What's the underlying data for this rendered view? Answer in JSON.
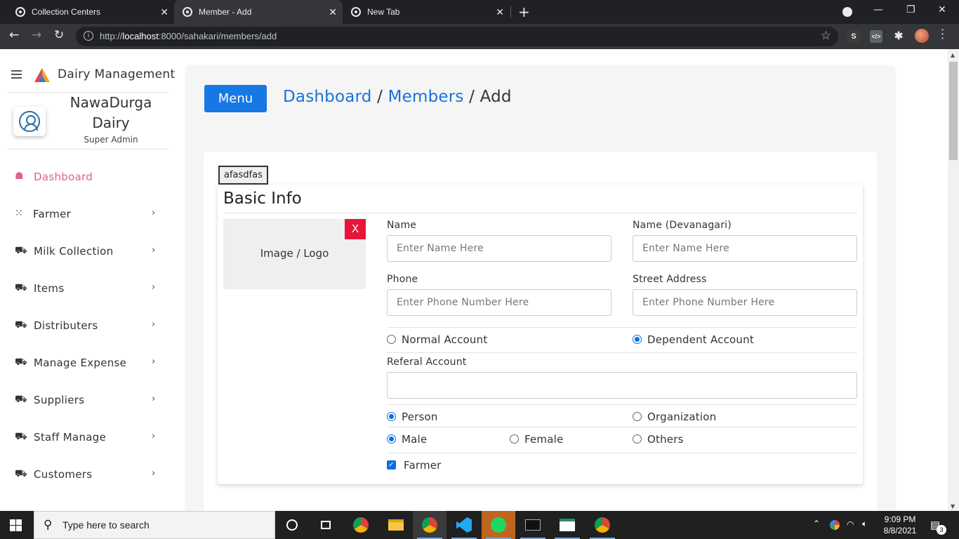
{
  "browser": {
    "tabs": [
      {
        "title": "Collection Centers"
      },
      {
        "title": "Member - Add"
      },
      {
        "title": "New Tab"
      }
    ],
    "url_host": "localhost",
    "url_prefix": "http://",
    "url_rest": ":8000/sahakari/members/add",
    "extensions": [
      "S",
      "</>"
    ]
  },
  "sidebar": {
    "app_title": "Dairy Management",
    "org_name": "NawaDurga Dairy",
    "org_role": "Super Admin",
    "items": [
      {
        "label": "Dashboard",
        "icon": "home-icon",
        "active": true
      },
      {
        "label": "Farmer",
        "icon": "grid-icon"
      },
      {
        "label": "Milk Collection",
        "icon": "cart-icon"
      },
      {
        "label": "Items",
        "icon": "cart-icon"
      },
      {
        "label": "Distributers",
        "icon": "cart-icon"
      },
      {
        "label": "Manage Expense",
        "icon": "cart-icon"
      },
      {
        "label": "Suppliers",
        "icon": "cart-icon"
      },
      {
        "label": "Staff Manage",
        "icon": "cart-icon"
      },
      {
        "label": "Customers",
        "icon": "cart-icon"
      }
    ]
  },
  "header": {
    "menu_label": "Menu",
    "breadcrumb": [
      "Dashboard",
      "Members",
      "Add"
    ],
    "separator": "/"
  },
  "form": {
    "tag_label": "afasdfas",
    "section_title": "Basic Info",
    "image_placeholder": "Image / Logo",
    "remove_label": "X",
    "name": {
      "label": "Name",
      "placeholder": "Enter Name Here",
      "value": ""
    },
    "name_devanagari": {
      "label": "Name (Devanagari)",
      "placeholder": "Enter Name Here",
      "value": ""
    },
    "phone": {
      "label": "Phone",
      "placeholder": "Enter Phone Number Here",
      "value": ""
    },
    "street_address": {
      "label": "Street Address",
      "placeholder": "Enter Phone Number Here",
      "value": ""
    },
    "account_type": {
      "options": [
        "Normal Account",
        "Dependent Account"
      ],
      "selected": "Dependent Account"
    },
    "referal_account": {
      "label": "Referal Account",
      "value": ""
    },
    "entity_type": {
      "options": [
        "Person",
        "Organization"
      ],
      "selected": "Person"
    },
    "gender": {
      "options": [
        "Male",
        "Female",
        "Others"
      ],
      "selected": "Male"
    },
    "farmer": {
      "label": "Farmer",
      "checked": true
    }
  },
  "taskbar": {
    "search_placeholder": "Type here to search",
    "time": "9:09 PM",
    "date": "8/8/2021",
    "notification_count": "3"
  },
  "colors": {
    "accent_blue": "#1677e5",
    "link_blue": "#1a73d9",
    "active_pink": "#e0628a",
    "danger_red": "#e8153a"
  }
}
